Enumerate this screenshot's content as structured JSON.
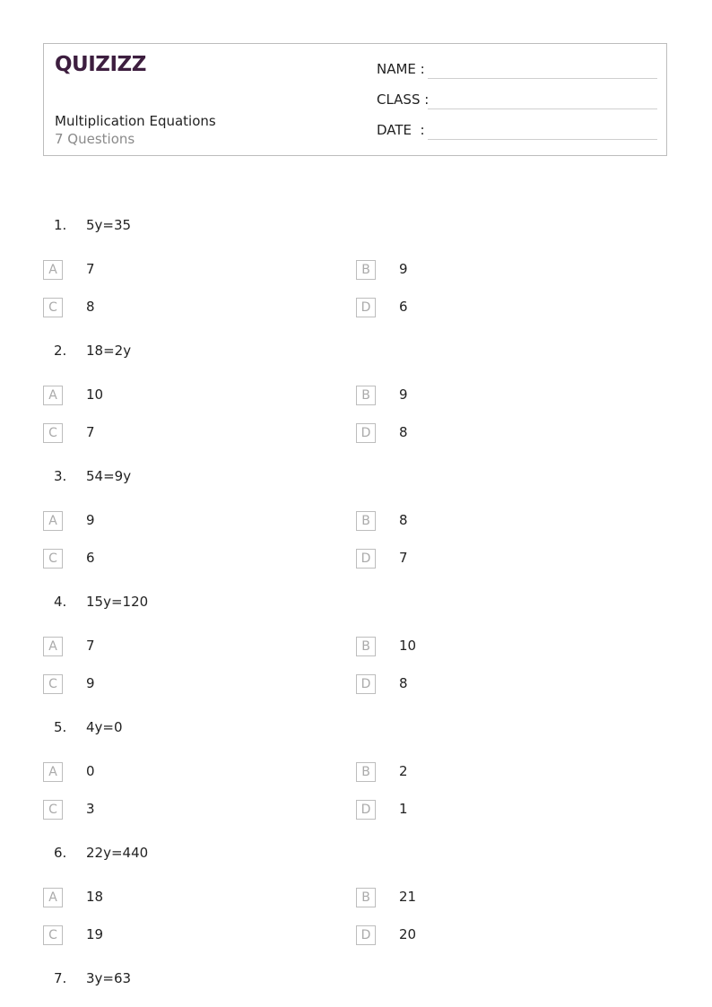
{
  "header": {
    "logo": "QUIZIZZ",
    "title": "Multiplication Equations",
    "subtitle": "7 Questions",
    "fields": [
      {
        "label": "NAME :"
      },
      {
        "label": "CLASS :"
      },
      {
        "label": "DATE  :"
      }
    ]
  },
  "questions": [
    {
      "number": "1.",
      "text": "5y=35",
      "options": [
        {
          "letter": "A",
          "value": "7"
        },
        {
          "letter": "B",
          "value": "9"
        },
        {
          "letter": "C",
          "value": "8"
        },
        {
          "letter": "D",
          "value": "6"
        }
      ]
    },
    {
      "number": "2.",
      "text": "18=2y",
      "options": [
        {
          "letter": "A",
          "value": "10"
        },
        {
          "letter": "B",
          "value": "9"
        },
        {
          "letter": "C",
          "value": "7"
        },
        {
          "letter": "D",
          "value": "8"
        }
      ]
    },
    {
      "number": "3.",
      "text": "54=9y",
      "options": [
        {
          "letter": "A",
          "value": "9"
        },
        {
          "letter": "B",
          "value": "8"
        },
        {
          "letter": "C",
          "value": "6"
        },
        {
          "letter": "D",
          "value": "7"
        }
      ]
    },
    {
      "number": "4.",
      "text": "15y=120",
      "options": [
        {
          "letter": "A",
          "value": "7"
        },
        {
          "letter": "B",
          "value": "10"
        },
        {
          "letter": "C",
          "value": "9"
        },
        {
          "letter": "D",
          "value": "8"
        }
      ]
    },
    {
      "number": "5.",
      "text": "4y=0",
      "options": [
        {
          "letter": "A",
          "value": "0"
        },
        {
          "letter": "B",
          "value": "2"
        },
        {
          "letter": "C",
          "value": "3"
        },
        {
          "letter": "D",
          "value": "1"
        }
      ]
    },
    {
      "number": "6.",
      "text": "22y=440",
      "options": [
        {
          "letter": "A",
          "value": "18"
        },
        {
          "letter": "B",
          "value": "21"
        },
        {
          "letter": "C",
          "value": "19"
        },
        {
          "letter": "D",
          "value": "20"
        }
      ]
    },
    {
      "number": "7.",
      "text": "3y=63",
      "options": []
    }
  ]
}
